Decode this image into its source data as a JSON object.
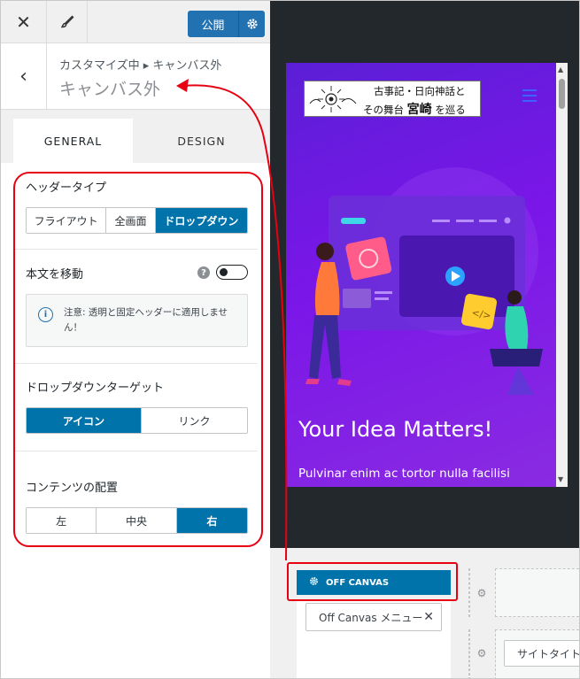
{
  "topbar": {
    "close_label": "✕",
    "publish_label": "公開"
  },
  "section": {
    "breadcrumb": "カスタマイズ中 ▸ キャンバス外",
    "title": "キャンバス外"
  },
  "tabs": [
    {
      "label": "GENERAL"
    },
    {
      "label": "DESIGN"
    }
  ],
  "header_type": {
    "label": "ヘッダータイプ",
    "options": [
      "フライアウト",
      "全画面",
      "ドロップダウン"
    ],
    "selected": "ドロップダウン"
  },
  "move_body": {
    "label": "本文を移動",
    "enabled": false
  },
  "notice": {
    "text": "注意: 透明と固定ヘッダーに適用しません！"
  },
  "dropdown_target": {
    "label": "ドロップダウンターゲット",
    "options": [
      "アイコン",
      "リンク"
    ],
    "selected": "アイコン"
  },
  "content_alignment": {
    "label": "コンテンツの配置",
    "options": [
      "左",
      "中央",
      "右"
    ],
    "selected": "右"
  },
  "preview": {
    "logo_line1": "古事記・日向神話と",
    "logo_line2a": "その舞台",
    "logo_line2b": "宮崎",
    "logo_line2c": "を巡る",
    "hero_title": "Your Idea Matters!",
    "hero_subtitle": "Pulvinar enim ac tortor nulla facilisi"
  },
  "builder": {
    "offcanvas_label": "OFF CANVAS",
    "menu_chip": "Off Canvas メニュー",
    "site_title_chip": "サイトタイト"
  },
  "colors": {
    "accent": "#0073aa",
    "highlight": "#e60012",
    "preview_bg": "#7a16e8"
  }
}
